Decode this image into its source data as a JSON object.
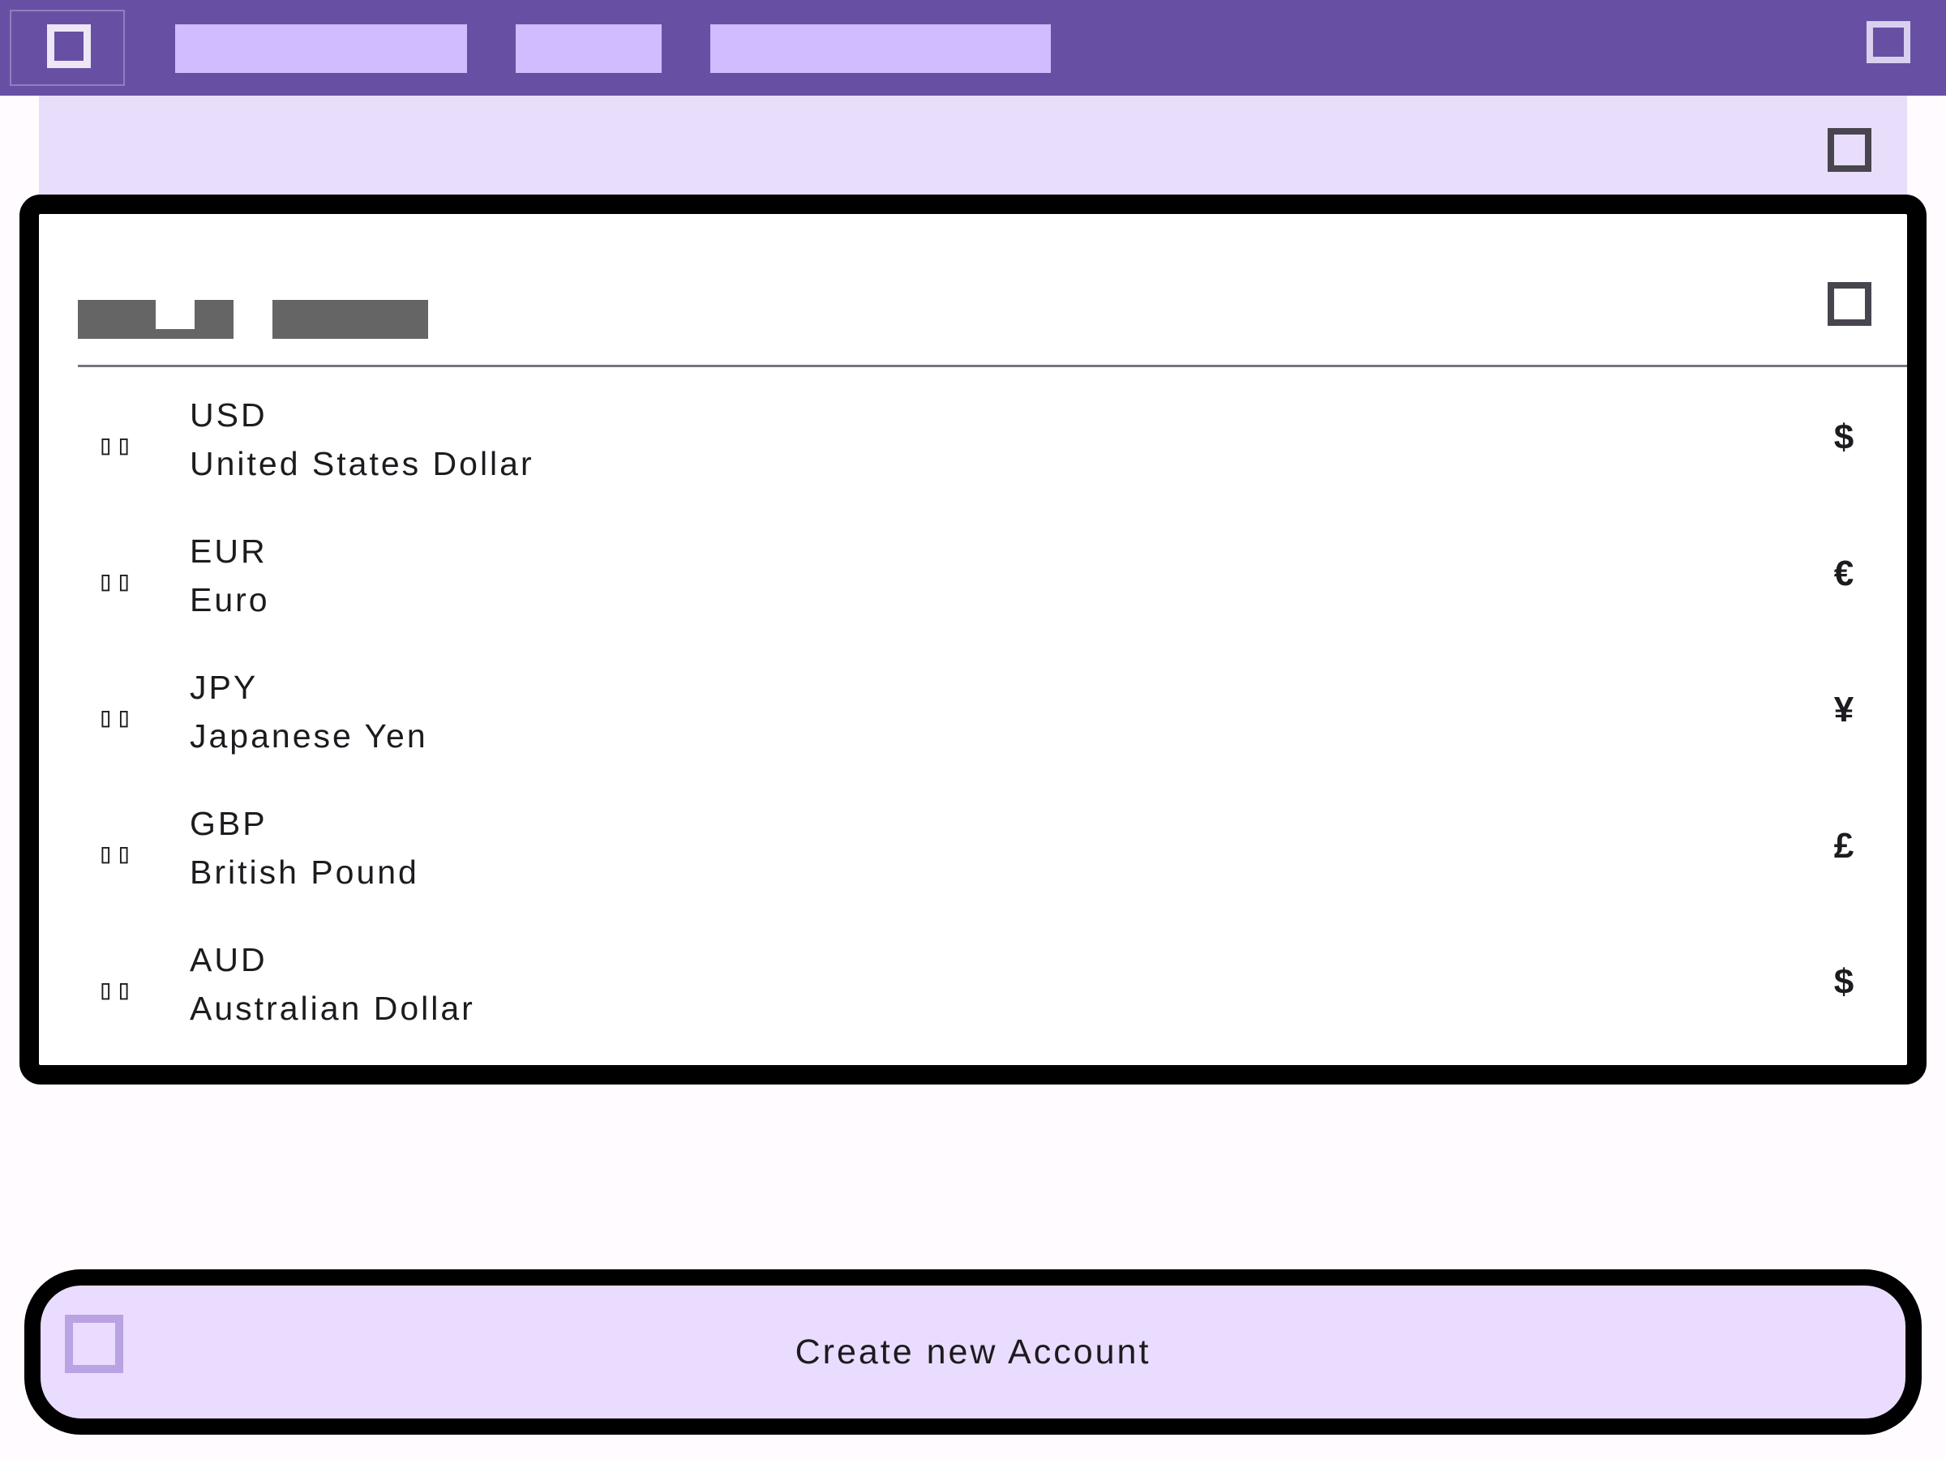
{
  "colors": {
    "app_bar": "#6750a4",
    "tab_placeholder": "#d0bcff",
    "secondary_bar": "#e8defc",
    "button_container": "#eadcfe",
    "text": "#1c1b1f"
  },
  "app_bar": {
    "menu_icon": "square-icon",
    "action_icon": "square-icon"
  },
  "secondary_bar": {
    "action_icon": "square-icon"
  },
  "currency_picker": {
    "close_icon": "square-icon",
    "currencies": [
      {
        "flag": "▯▯",
        "code": "USD",
        "name": "United States Dollar",
        "symbol": "$"
      },
      {
        "flag": "▯▯",
        "code": "EUR",
        "name": "Euro",
        "symbol": "€"
      },
      {
        "flag": "▯▯",
        "code": "JPY",
        "name": "Japanese Yen",
        "symbol": "¥"
      },
      {
        "flag": "▯▯",
        "code": "GBP",
        "name": "British Pound",
        "symbol": "£"
      },
      {
        "flag": "▯▯",
        "code": "AUD",
        "name": "Australian Dollar",
        "symbol": "$"
      }
    ]
  },
  "create_account": {
    "label": "Create new Account",
    "icon": "square-icon"
  }
}
